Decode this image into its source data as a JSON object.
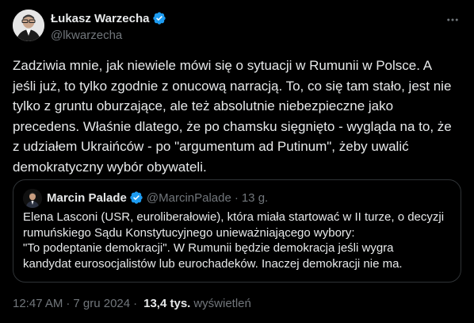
{
  "author": {
    "display_name": "Łukasz Warzecha",
    "handle": "@lkwarzecha",
    "verified_icon": "verified-badge-icon"
  },
  "more_icon": "more-options-icon",
  "tweet": {
    "text": "Zadziwia mnie, jak niewiele mówi się o sytuacji w Rumunii w Polsce. A\njeśli już, to tylko zgodnie z onucową narracją. To, co się tam stało, jest nie\ntylko z gruntu oburzające, ale też absolutnie niebezpieczne jako\nprecedens. Właśnie dlatego, że po chamsku sięgnięto - wygląda na to, że\nz udziałem Ukraińców - po \"argumentum ad Putinum\", żeby uwalić\ndemokratyczny wybór obywateli."
  },
  "quoted": {
    "display_name": "Marcin Palade",
    "handle": "@MarcinPalade",
    "time": "13 g.",
    "dot": "·",
    "text": "Elena Lasconi (USR, euroliberałowie), która miała startować w II turze, o decyzji\nrumuńskiego Sądu Konstytucyjnego unieważniającego wybory:\n\"To podeptanie demokracji\". W Rumunii będzie demokracja jeśli wygra\nkandydat eurosocjalistów lub eurochadeków. Inaczej demokracji nie ma."
  },
  "footer": {
    "time": "12:47 AM",
    "dot": "·",
    "date": "7 gru 2024",
    "views_count": "13,4 tys.",
    "views_label": "wyświetleń"
  },
  "colors": {
    "background": "#000000",
    "text_primary": "#e7e9ea",
    "text_secondary": "#71767b",
    "verified_blue": "#1d9bf0",
    "border": "#2f3336"
  }
}
